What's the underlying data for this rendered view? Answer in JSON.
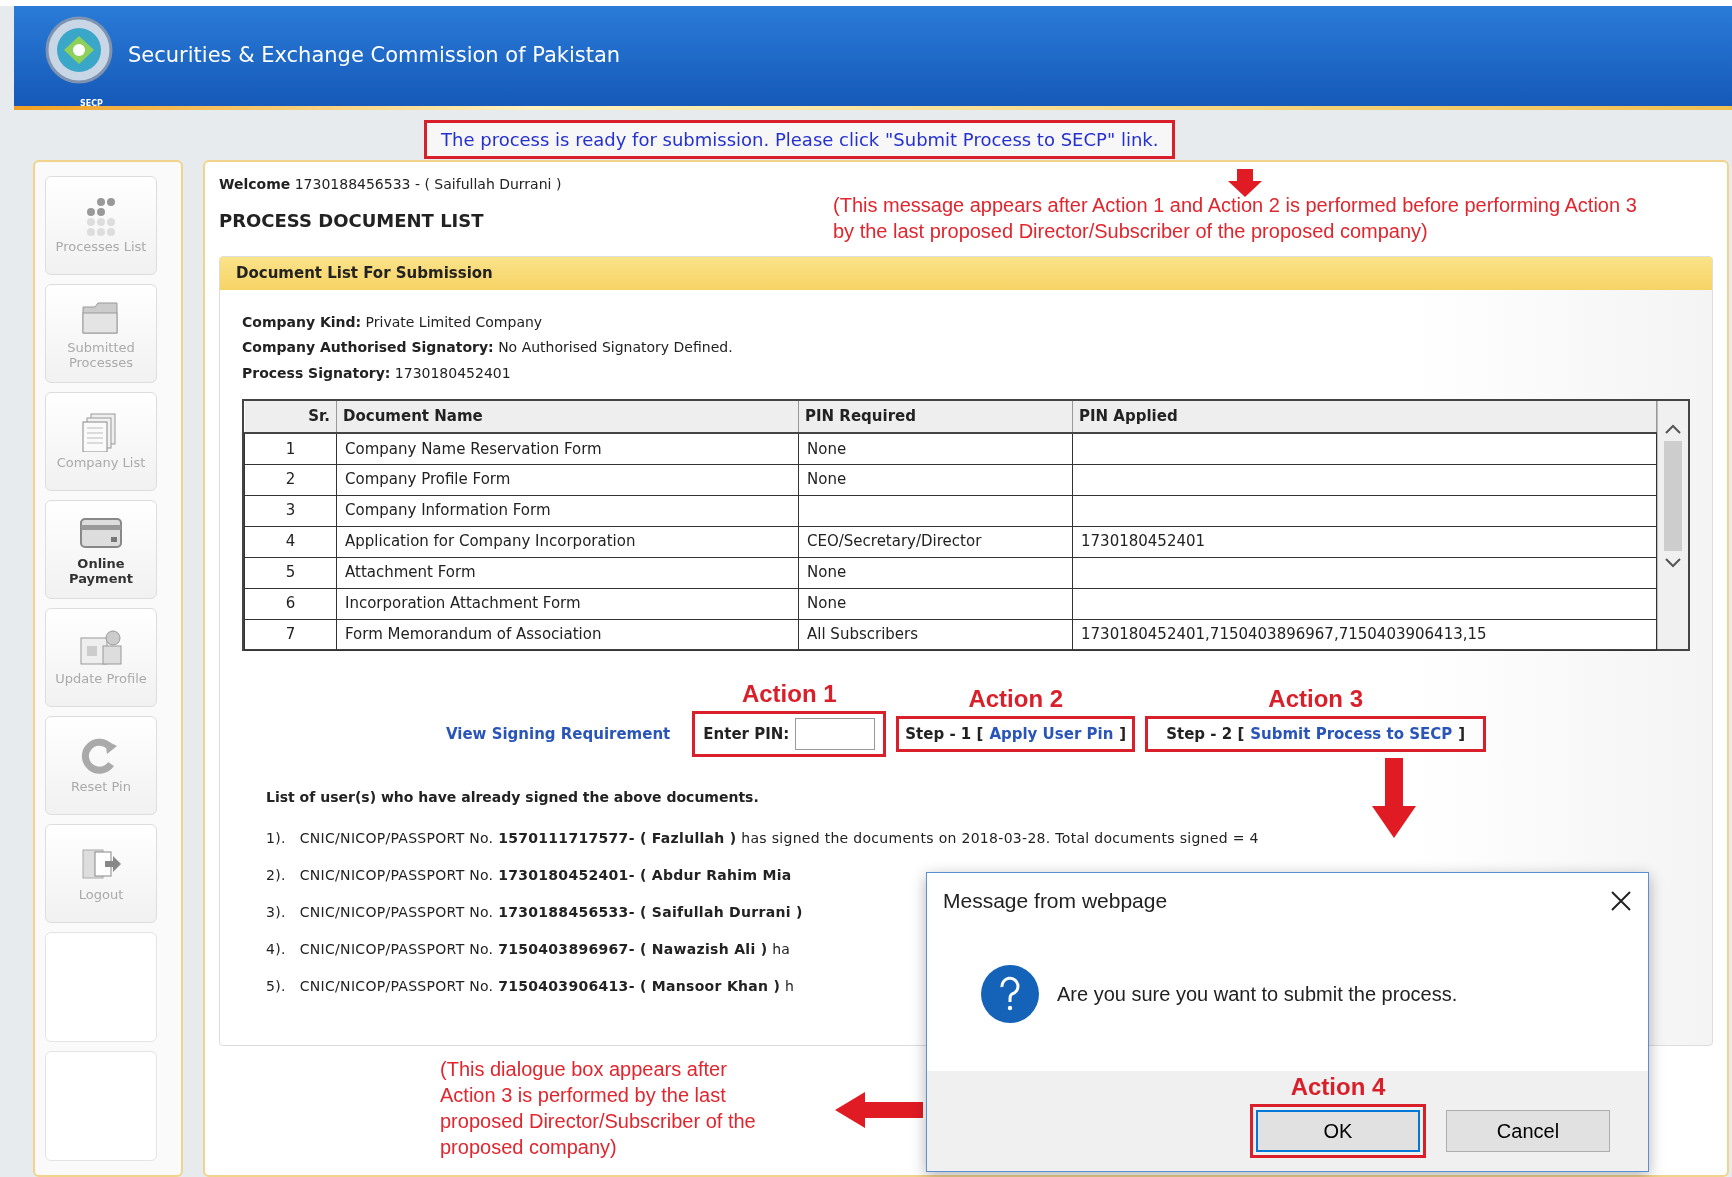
{
  "header": {
    "title": "Securities & Exchange Commission of Pakistan",
    "logo_caption": "SECP"
  },
  "notice": "The process is ready for submission. Please click \"Submit Process to SECP\" link.",
  "sidebar": {
    "items": [
      {
        "label": "Processes List",
        "disabled": true
      },
      {
        "label": "Submitted Processes",
        "disabled": true
      },
      {
        "label": "Company List",
        "disabled": true
      },
      {
        "label": "Online Payment",
        "disabled": false
      },
      {
        "label": "Update Profile",
        "disabled": true
      },
      {
        "label": "Reset Pin",
        "disabled": true
      },
      {
        "label": "Logout",
        "disabled": true
      }
    ]
  },
  "welcome": {
    "label": "Welcome",
    "value": "1730188456533 - ( Saifullah Durrani )"
  },
  "page_title": "PROCESS DOCUMENT LIST",
  "panel": {
    "title": "Document List For Submission",
    "fields": [
      {
        "label": "Company Kind:",
        "value": "Private Limited Company"
      },
      {
        "label": "Company Authorised Signatory:",
        "value": "No Authorised Signatory Defined."
      },
      {
        "label": "Process Signatory:",
        "value": "1730180452401"
      }
    ]
  },
  "table": {
    "columns": [
      "Sr.",
      "Document Name",
      "PIN Required",
      "PIN Applied"
    ],
    "rows": [
      {
        "sr": "1",
        "document": "Company Name Reservation Form",
        "pin_required": "None"
      },
      {
        "sr": "2",
        "document": "Company Profile Form",
        "pin_required": "None"
      },
      {
        "sr": "3",
        "document": "Company Information Form"
      },
      {
        "sr": "4",
        "document": "Application for Company Incorporation",
        "pin_required": "CEO/Secretary/Director",
        "pin_applied": "1730180452401"
      },
      {
        "sr": "5",
        "document": "Attachment Form",
        "pin_required": "None"
      },
      {
        "sr": "6",
        "document": "Incorporation Attachment Form",
        "pin_required": "None"
      },
      {
        "sr": "7",
        "document": "Form Memorandum of Association",
        "pin_required": "All Subscribers",
        "pin_applied": "1730180452401,7150403896967,7150403906413,15"
      }
    ]
  },
  "actions": {
    "view_link": "View Signing Requirement",
    "pin_label": "Enter PIN:",
    "step1": {
      "prefix": "Step - 1 [",
      "link": "Apply User Pin",
      "suffix": "]"
    },
    "step2": {
      "prefix": "Step - 2 [",
      "link": "Submit Process to SECP",
      "suffix": "]"
    }
  },
  "signed_users": {
    "heading": "List of user(s) who have already signed the above documents.",
    "items": [
      {
        "index": "1).",
        "text": "CNIC/NICOP/PASSPORT No. **1570111717577- ( Fazlullah )** has signed the documents on 2018-03-28. Total documents signed = 4"
      },
      {
        "index": "2).",
        "text": "CNIC/NICOP/PASSPORT No. **1730180452401- ( Abdur Rahim Mia**"
      },
      {
        "index": "3).",
        "text": "CNIC/NICOP/PASSPORT No. **1730188456533- ( Saifullah Durrani )**"
      },
      {
        "index": "4).",
        "text": "CNIC/NICOP/PASSPORT No. **7150403896967- ( Nawazish Ali )** ha"
      },
      {
        "index": "5).",
        "text": "CNIC/NICOP/PASSPORT No. **7150403906413- ( Mansoor Khan )** h"
      }
    ]
  },
  "dialog": {
    "title": "Message from webpage",
    "message": "Are you sure you want to submit the process.",
    "buttons": [
      {
        "label": "OK",
        "selected": true
      },
      {
        "label": "Cancel",
        "selected": false
      }
    ]
  },
  "annotations": {
    "notice_note": "(This message appears after Action 1 and Action 2 is performed before performing Action 3 by the last proposed Director/Subscriber of the proposed company)",
    "action_labels": [
      "Action 1",
      "Action 2",
      "Action 3",
      "Action 4"
    ],
    "dialog_note": "(This dialogue box appears after Action 3 is performed by the last proposed Director/Subscriber of the proposed company)"
  }
}
